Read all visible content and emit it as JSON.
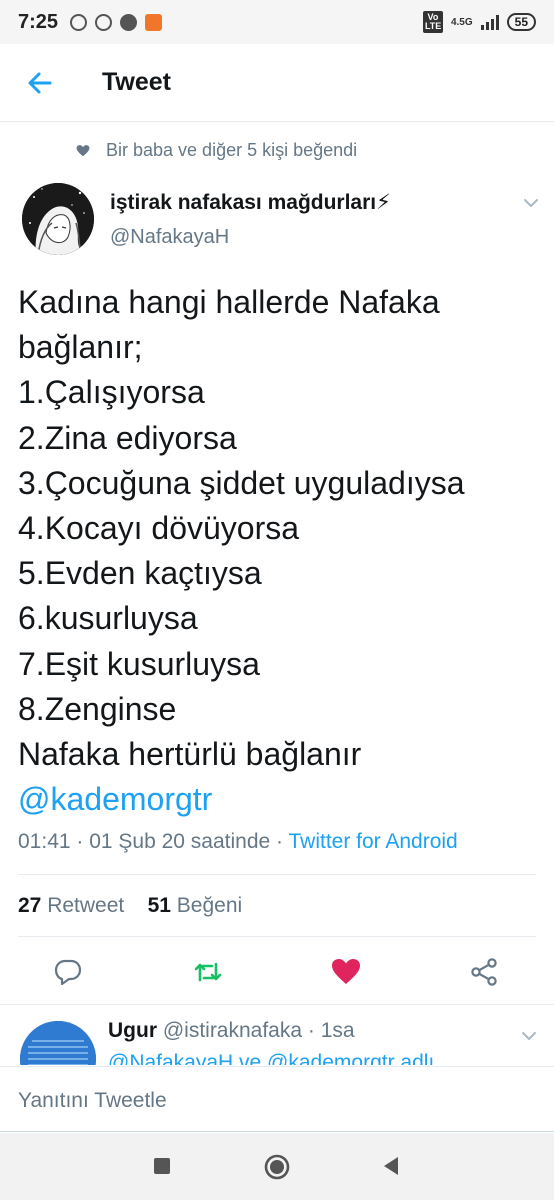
{
  "status_bar": {
    "time": "7:25",
    "network_badge": "Vo LTE",
    "network_type": "4.5G",
    "battery": "55"
  },
  "header": {
    "back_icon": "arrow-left-icon",
    "title": "Tweet"
  },
  "social_context": {
    "text": "Bir baba ve diğer 5 kişi beğendi"
  },
  "author": {
    "name": "iştirak nafakası mağdurları⚡",
    "handle": "@NafakayaH"
  },
  "tweet": {
    "lines": [
      "Kadına hangi hallerde Nafaka",
      "bağlanır;",
      "1.Çalışıyorsa",
      "2.Zina ediyorsa",
      "3.Çocuğuna şiddet uyguladıysa",
      "4.Kocayı dövüyorsa",
      "5.Evden kaçtıysa",
      "6.kusurluysa",
      "7.Eşit kusurluysa",
      "8.Zenginse",
      "Nafaka hertürlü bağlanır"
    ],
    "mention": "@kademorgtr",
    "timestamp": "01:41 · 01 Şub 20 saatinde · ",
    "source": "Twitter for Android"
  },
  "stats": {
    "retweets_count": "27",
    "retweets_label": "Retweet",
    "likes_count": "51",
    "likes_label": "Beğeni"
  },
  "actions": {
    "reply_icon": "reply-icon",
    "retweet_icon": "retweet-icon",
    "like_icon": "heart-icon",
    "share_icon": "share-icon",
    "retweet_color": "#17bf63",
    "like_color": "#e0245e"
  },
  "reply_preview": {
    "name": "Ugur",
    "handle_time": " @istiraknafaka · 1sa",
    "text": "@NafakayaH ve @kademorgtr adlı"
  },
  "compose": {
    "placeholder": "Yanıtını Tweetle"
  },
  "colors": {
    "accent": "#1da1f2",
    "muted": "#657786",
    "text": "#14171a"
  }
}
